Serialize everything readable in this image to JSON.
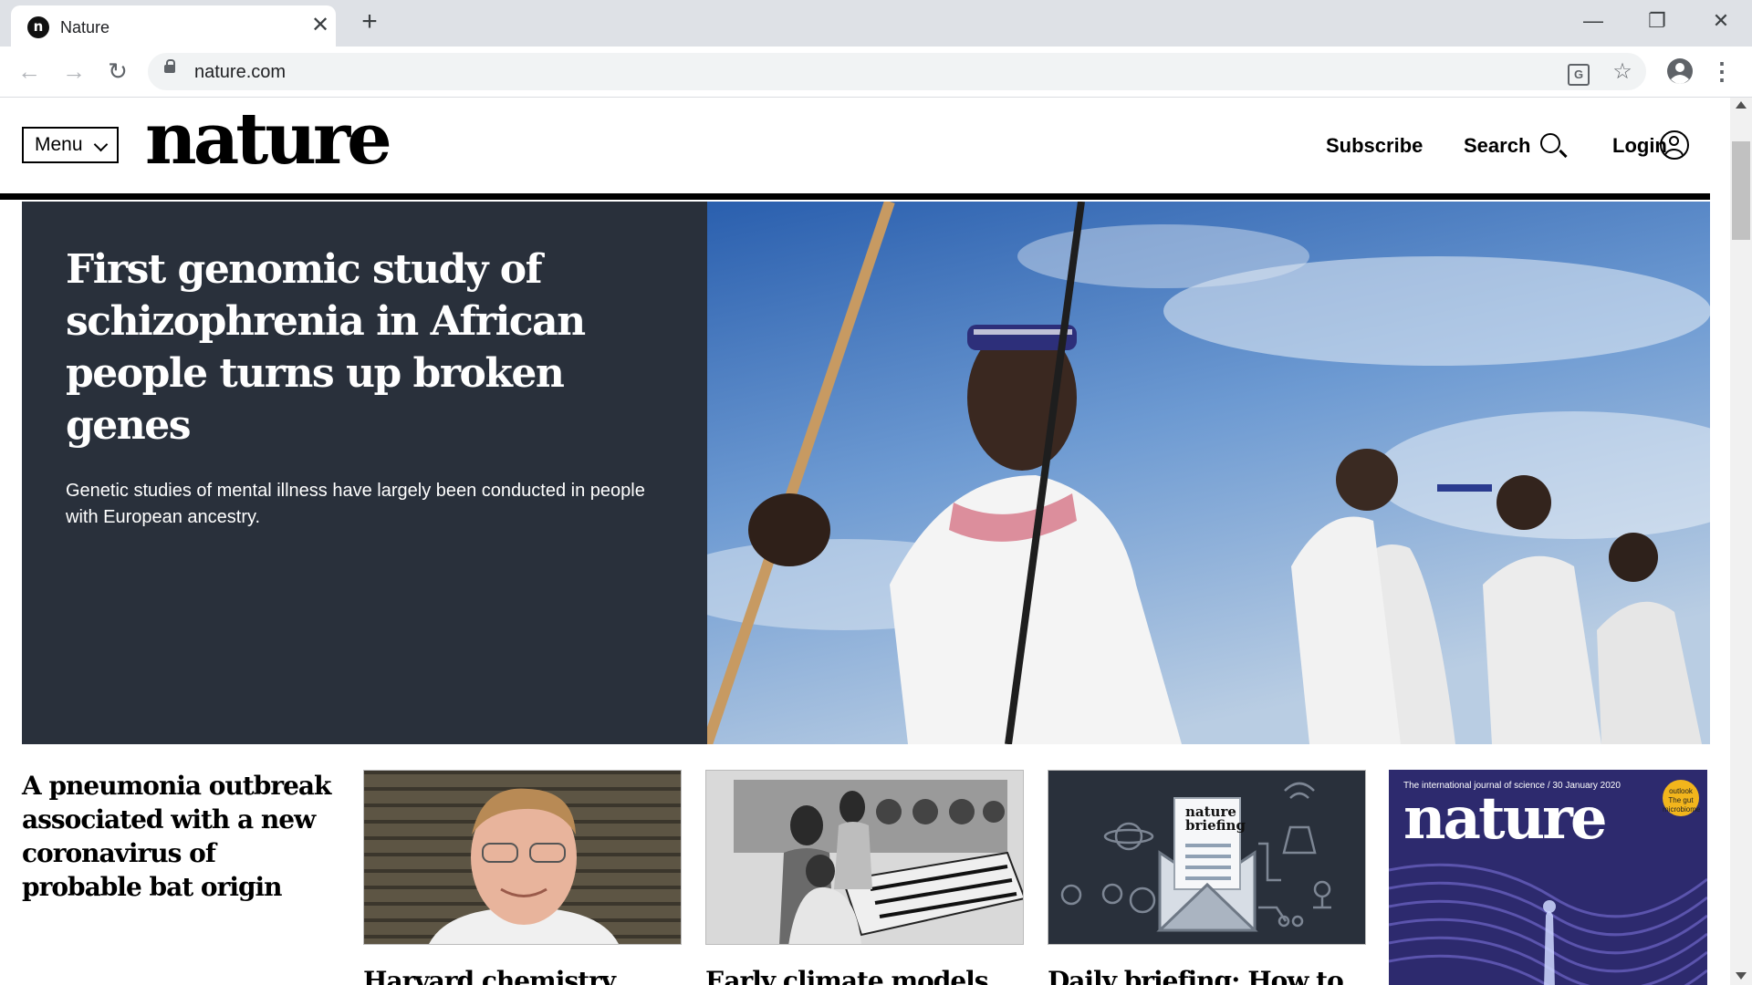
{
  "browser": {
    "tab_title": "Nature",
    "favicon_letter": "n",
    "tab_close": "✕",
    "new_tab": "+",
    "window_controls": {
      "minimize": "—",
      "restore": "❐",
      "close": "✕"
    },
    "back": "←",
    "forward": "→",
    "reload": "↻",
    "url": "nature.com",
    "bookmark": "☆",
    "translate": "G",
    "menu_dots": "⋮"
  },
  "site": {
    "menu_label": "Menu",
    "logo_text": "nature",
    "nav": {
      "subscribe": "Subscribe",
      "search": "Search",
      "login": "Login"
    }
  },
  "hero": {
    "title": "First genomic study of schizophrenia in African people turns up broken genes",
    "description": "Genetic studies of mental illness have largely been conducted in people with European ancestry."
  },
  "lead_story": {
    "title": "A pneumonia outbreak associated with a new coronavirus of probable bat origin"
  },
  "cards": [
    {
      "title": "Harvard chemistry"
    },
    {
      "title": "Early climate models"
    },
    {
      "title": "Daily briefing: How to"
    }
  ],
  "briefing_card": {
    "line1": "nature",
    "line2": "briefing"
  },
  "cover": {
    "tagline": "The international journal of science / 30 January 2020",
    "logo": "nature",
    "badge": "outlook The gut microbiome"
  },
  "colors": {
    "hero_panel": "#29303b",
    "tabstrip": "#dee1e6",
    "briefing_bg": "#29303b",
    "cover_bg": "#2d2a6e"
  }
}
